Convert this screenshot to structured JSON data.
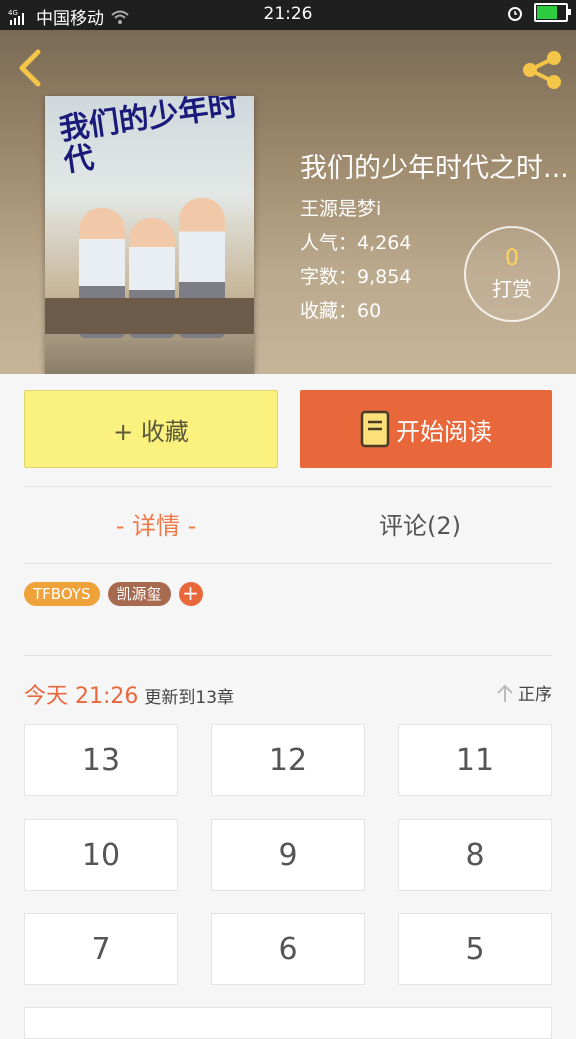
{
  "status_bar": {
    "carrier": "中国移动",
    "signal_tag": "4G",
    "time": "21:26"
  },
  "book": {
    "title": "我们的少年时代之时...",
    "author": "王源是梦i",
    "popularity_label": "人气：",
    "popularity": "4,264",
    "words_label": "字数：",
    "words": "9,854",
    "favorites_label": "收藏：",
    "favorites": "60",
    "cover_text": "我们的少年时代"
  },
  "tip": {
    "count": "0",
    "label": "打赏"
  },
  "actions": {
    "favorite": "+ 收藏",
    "read": "开始阅读"
  },
  "tabs": {
    "details": "- 详情 -",
    "comments": "评论(2)"
  },
  "tags": [
    {
      "label": "TFBOYS",
      "color": "#f0a23a"
    },
    {
      "label": "凯源玺",
      "color": "#a86a4e"
    }
  ],
  "tag_add": "+",
  "update": {
    "time": "今天 21:26",
    "text": "更新到13章",
    "sort": "正序"
  },
  "chapters": [
    "13",
    "12",
    "11",
    "10",
    "9",
    "8",
    "7",
    "6",
    "5"
  ],
  "colors": {
    "accent": "#e8673b",
    "fav_bg": "#fbf17f"
  }
}
